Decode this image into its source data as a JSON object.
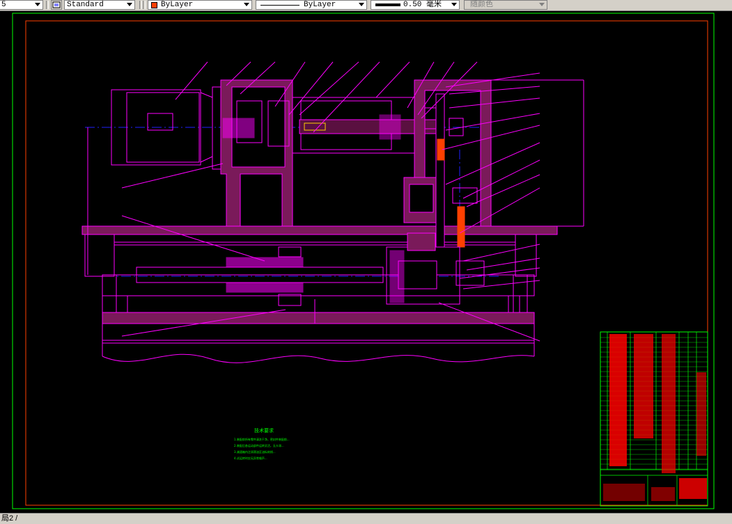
{
  "toolbar": {
    "first_select": "5",
    "text_style": "Standard",
    "color": "ByLayer",
    "color_swatch": "#ff4000",
    "linetype": "ByLayer",
    "lineweight": "0.50 毫米",
    "plot_style": "随颜色"
  },
  "status_bar": {
    "layout_tab": "局2 /"
  },
  "colors": {
    "background": "#000000",
    "outline": "#ff00ff",
    "frame": "#ff4000",
    "border": "#00ff00",
    "centerline": "#0000ff",
    "leader": "#ff00ff",
    "notes_text": "#00ff00",
    "title_block_text": "#ff0000"
  },
  "drawing": {
    "notes_title": "技术要求",
    "notes_lines": [
      "1.装配前所有零件清洗干净，密封件装配前...",
      "2.装配后各运动部件运转灵活，无卡滞...",
      "3.减速箱内注润滑油至油标刻线...",
      "4.试运转时应无异常噪声..."
    ]
  }
}
